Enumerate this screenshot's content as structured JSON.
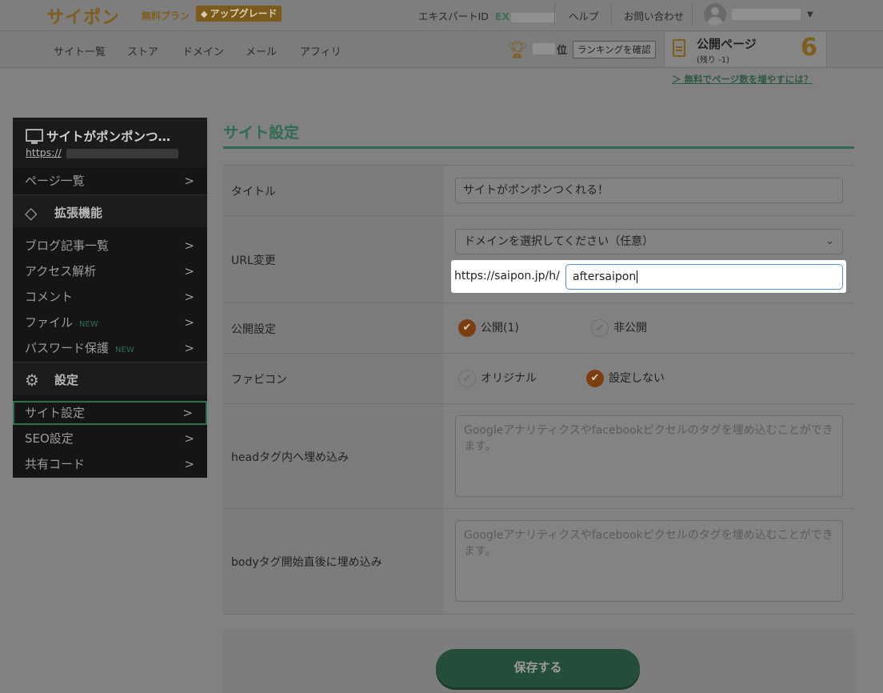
{
  "header": {
    "logo": "サイポン",
    "plan": "無料プラン",
    "upgrade_label": "アップグレード",
    "expert_label": "エキスパートID",
    "expert_prefix": "EX",
    "help": "ヘルプ",
    "contact": "お問い合わせ"
  },
  "nav": {
    "items": [
      "サイト一覧",
      "ストア",
      "ドメイン",
      "メール",
      "アフィリ"
    ],
    "rank_suffix": "位",
    "rank_button": "ランキングを確認",
    "public_pages_title": "公開ページ",
    "public_pages_sub": "(残り -1)",
    "public_pages_count": "6",
    "more_pages_link": "＞ 無料でページ数を増やすには？"
  },
  "sidebar": {
    "site_title": "サイトがポンポンつ…",
    "site_url_prefix": "https://",
    "pages_item": "ページ一覧",
    "ext_section": "拡張機能",
    "ext_items": [
      "ブログ記事一覧",
      "アクセス解析",
      "コメント",
      "ファイル",
      "パスワード保護"
    ],
    "new_tag": "NEW",
    "settings_section": "設定",
    "settings_items": [
      "サイト設定",
      "SEO設定",
      "共有コード"
    ]
  },
  "main": {
    "page_title": "サイト設定",
    "title_label": "タイトル",
    "title_value": "サイトがポンポンつくれる！",
    "url_label": "URL変更",
    "domain_select": "ドメインを選択してください（任意）",
    "url_prefix": "https://saipon.jp/h/",
    "url_value": "aftersaipon",
    "publish_label": "公開設定",
    "publish_on": "公開(1)",
    "publish_off": "非公開",
    "favicon_label": "ファビコン",
    "favicon_original": "オリジナル",
    "favicon_none": "設定しない",
    "head_label": "headタグ内へ埋め込み",
    "head_placeholder": "Googleアナリティクスやfacebookピクセルのタグを埋め込むことができます。",
    "body_label": "bodyタグ開始直後に埋め込み",
    "body_placeholder": "Googleアナリティクスやfacebookピクセルのタグを埋め込むことができます。",
    "save_label": "保存する"
  }
}
